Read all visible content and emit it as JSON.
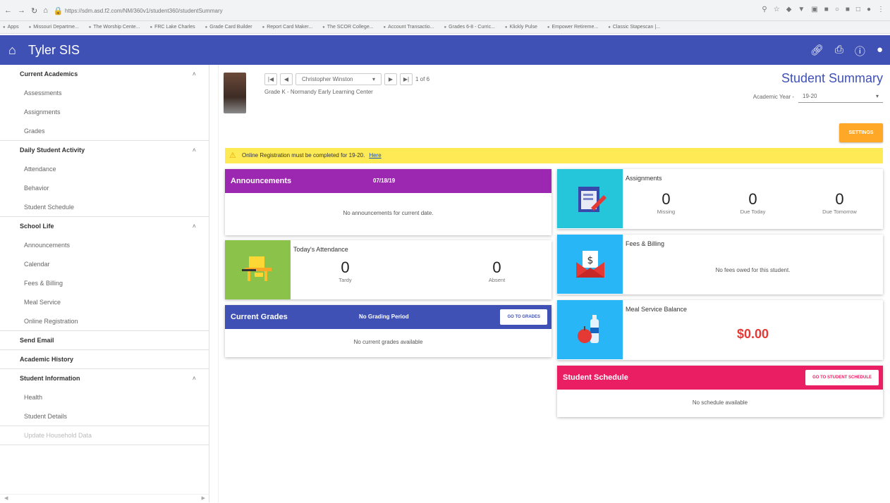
{
  "browser": {
    "url": "https://sdm.asd.f2.com/NM/360v1/student360/studentSummary",
    "bookmarks": [
      "Apps",
      "Missouri Departme...",
      "The Worship Cente...",
      "FRC Lake Charles",
      "Grade Card Builder",
      "Report Card Maker...",
      "The SCOR College...",
      "Account Transactio...",
      "Grades 6-8 - Curric...",
      "Klickly Pulse",
      "Empower Retireme...",
      "Classic Stapescan |..."
    ]
  },
  "app": {
    "title": "Tyler SIS"
  },
  "sidebar": {
    "groups": [
      {
        "label": "Current Academics",
        "items": [
          "Assessments",
          "Assignments",
          "Grades"
        ]
      },
      {
        "label": "Daily Student Activity",
        "items": [
          "Attendance",
          "Behavior",
          "Student Schedule"
        ]
      },
      {
        "label": "School Life",
        "items": [
          "Announcements",
          "Calendar",
          "Fees & Billing",
          "Meal Service",
          "Online Registration"
        ]
      },
      {
        "label": "Send Email",
        "items": []
      },
      {
        "label": "Academic History",
        "items": []
      },
      {
        "label": "Student Information",
        "items": [
          "Health",
          "Student Details"
        ]
      }
    ],
    "footer_item": "Update Household Data"
  },
  "student": {
    "name": "Christopher Winston",
    "position": "1 of 6",
    "grade_school": "Grade K - Normandy Early Learning Center"
  },
  "header": {
    "page_title": "Student Summary",
    "academic_year_label": "Academic Year -",
    "academic_year_value": "19-20",
    "settings_label": "SETTINGS"
  },
  "notice": {
    "text": "Online Registration must be completed for 19-20.",
    "link": "Here"
  },
  "announcements": {
    "title": "Announcements",
    "date": "07/18/19",
    "message": "No announcements for current date.",
    "color": "#9c27b0"
  },
  "attendance": {
    "title": "Today's Attendance",
    "tardy_value": "0",
    "tardy_label": "Tardy",
    "absent_value": "0",
    "absent_label": "Absent"
  },
  "grades": {
    "title": "Current Grades",
    "period": "No Grading Period",
    "button": "GO TO GRADES",
    "message": "No current grades available",
    "color": "#3f51b5"
  },
  "assignments": {
    "title": "Assignments",
    "missing_value": "0",
    "missing_label": "Missing",
    "due_today_value": "0",
    "due_today_label": "Due Today",
    "due_tomorrow_value": "0",
    "due_tomorrow_label": "Due Tomorrow"
  },
  "fees": {
    "title": "Fees & Billing",
    "message": "No fees owed for this student."
  },
  "meal": {
    "title": "Meal Service Balance",
    "balance": "$0.00"
  },
  "schedule": {
    "title": "Student Schedule",
    "button": "GO TO STUDENT SCHEDULE",
    "message": "No schedule available",
    "color": "#e91e63"
  }
}
